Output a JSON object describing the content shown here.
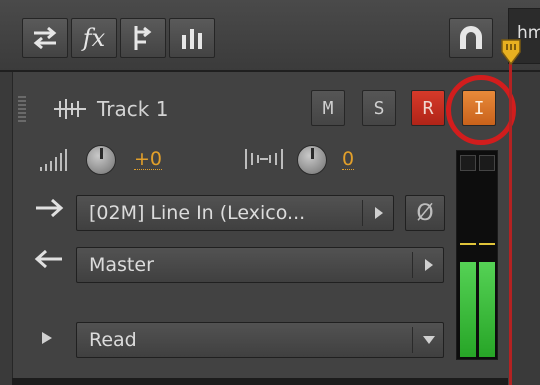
{
  "toolbar": {
    "buttons": [
      {
        "icon": "swap-arrows-icon"
      },
      {
        "icon": "fx-icon",
        "glyph": "fx"
      },
      {
        "icon": "routing-icon"
      },
      {
        "icon": "eq-bars-icon"
      }
    ],
    "snap_icon": "magnet-icon"
  },
  "timeline": {
    "label": "hm",
    "playhead_color": "#b42222",
    "marker_color": "#e8b020"
  },
  "track": {
    "name": "Track 1",
    "buttons": {
      "mute": "M",
      "solo": "S",
      "record": "R",
      "input": "I"
    },
    "volume": "+0",
    "pan": "0",
    "input_device": "[02M] Line In (Lexico...",
    "phase_glyph": "Ø",
    "output": "Master",
    "automation": "Read",
    "meter_level": 0.52
  },
  "colors": {
    "accent_orange": "#e3a02a",
    "record_red": "#c42e20",
    "input_orange": "#d7742a",
    "highlight_ring": "#d21d1d",
    "meter_green": "#3fbf3f"
  }
}
